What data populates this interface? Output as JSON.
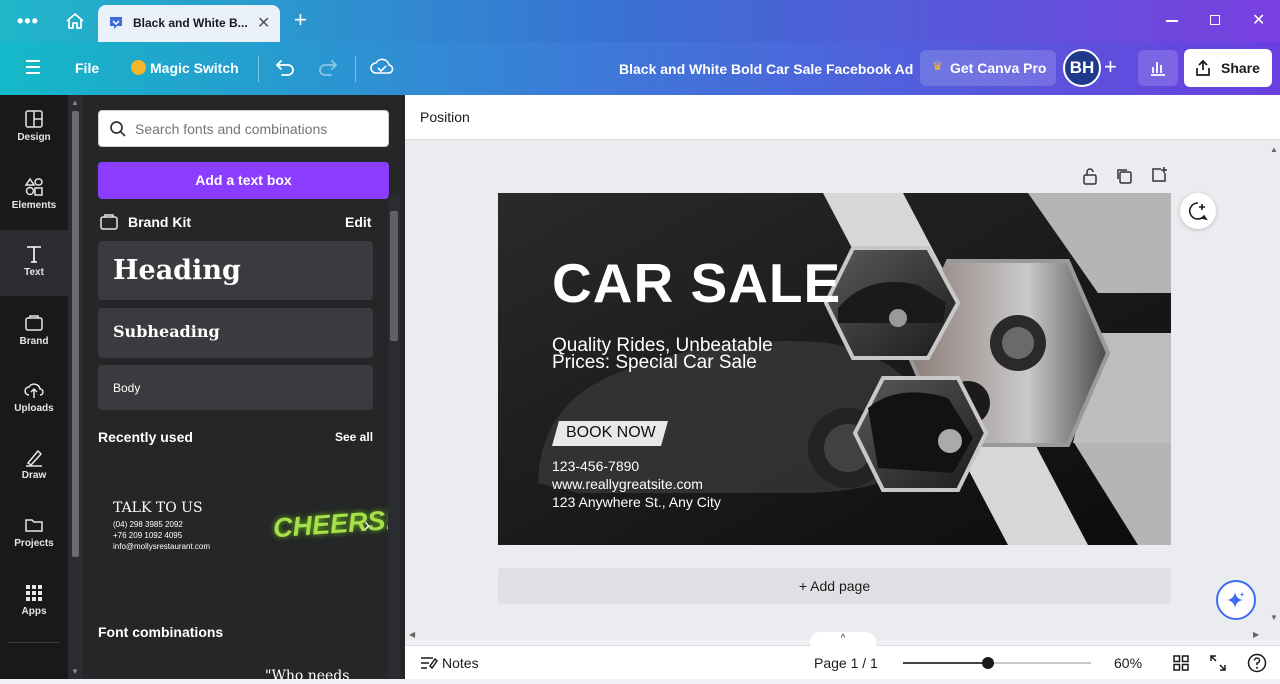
{
  "browser": {
    "tab_title": "Black and White B...",
    "new_tab_symbol": "+"
  },
  "toolbar": {
    "file": "File",
    "magic_switch": "Magic Switch",
    "doc_title": "Black and White Bold Car Sale Facebook Ad",
    "get_pro": "Get Canva Pro",
    "avatar": "BH",
    "share": "Share"
  },
  "rail": {
    "items": [
      {
        "label": "Design",
        "icon": "design-icon"
      },
      {
        "label": "Elements",
        "icon": "elements-icon"
      },
      {
        "label": "Text",
        "icon": "text-icon"
      },
      {
        "label": "Brand",
        "icon": "brand-icon"
      },
      {
        "label": "Uploads",
        "icon": "uploads-icon"
      },
      {
        "label": "Draw",
        "icon": "draw-icon"
      },
      {
        "label": "Projects",
        "icon": "projects-icon"
      },
      {
        "label": "Apps",
        "icon": "apps-icon"
      }
    ]
  },
  "panel": {
    "search_placeholder": "Search fonts and combinations",
    "add_text_box": "Add a text box",
    "brand_kit": "Brand Kit",
    "edit": "Edit",
    "heading": "Heading",
    "subheading": "Subheading",
    "body": "Body",
    "recently_used": "Recently used",
    "see_all": "See all",
    "recent1": {
      "title": "TALK TO US",
      "line1": "(04) 298 3985 2092",
      "line2": "+76 209 1092 4095",
      "line3": "info@mollysrestaurant.com"
    },
    "recent2": "CHEERS!",
    "font_combinations": "Font combinations",
    "combo_preview": "\"Who needs"
  },
  "context": {
    "position": "Position"
  },
  "design": {
    "headline": "CAR SALE",
    "sub1": "Quality Rides, Unbeatable",
    "sub2": "Prices: Special Car Sale",
    "cta": "BOOK NOW",
    "phone": "123-456-7890",
    "website": "www.reallygreatsite.com",
    "address": "123 Anywhere St., Any City"
  },
  "canvas": {
    "add_page": "+ Add page"
  },
  "bottom": {
    "notes": "Notes",
    "page": "Page 1 / 1",
    "zoom_percent": 60,
    "zoom_label": "60%"
  },
  "colors": {
    "accent_purple": "#8b3dff",
    "design_bg": "#1c1c1c",
    "panel_bg": "#252627"
  }
}
